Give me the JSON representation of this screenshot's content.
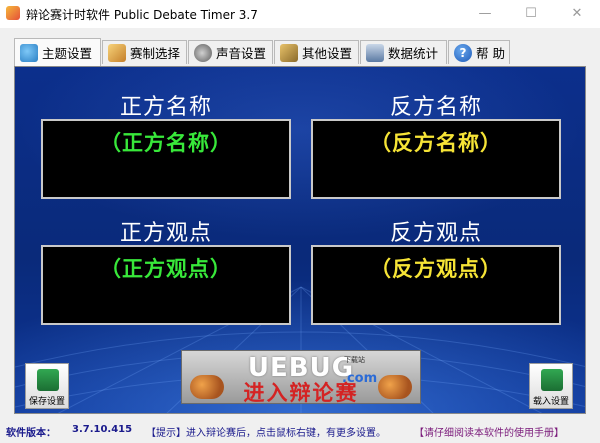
{
  "window": {
    "title": "辩论赛计时软件 Public Debate Timer 3.7",
    "controls": {
      "minimize": "—",
      "maximize": "☐",
      "close": "✕"
    }
  },
  "tabs": [
    {
      "label": "主题设置",
      "icon": "theme-settings-icon",
      "active": true
    },
    {
      "label": "赛制选择",
      "icon": "format-select-icon",
      "active": false
    },
    {
      "label": "声音设置",
      "icon": "speaker-icon",
      "active": false
    },
    {
      "label": "其他设置",
      "icon": "tools-icon",
      "active": false
    },
    {
      "label": "数据统计",
      "icon": "database-icon",
      "active": false
    },
    {
      "label": "帮 助",
      "icon": "help-icon",
      "active": false
    }
  ],
  "panel": {
    "affirmative_name_label": "正方名称",
    "affirmative_name_value": "（正方名称）",
    "negative_name_label": "反方名称",
    "negative_name_value": "（反方名称）",
    "affirmative_view_label": "正方观点",
    "affirmative_view_value": "（正方观点）",
    "negative_view_label": "反方观点",
    "negative_view_value": "（反方观点）",
    "enter_button": {
      "text": "进入辩论赛",
      "watermark": "UEBUG",
      "watermark_small": "下载站",
      "watermark_com": ".com"
    },
    "save_button": "保存设置",
    "load_button": "载入设置"
  },
  "statusbar": {
    "version_label": "软件版本：",
    "version_value": "3.7.10.415",
    "tip": "【提示】进入辩论赛后，点击鼠标右键，有更多设置。",
    "manual": "【请仔细阅读本软件的使用手册】"
  },
  "colors": {
    "panel_blue": "#0b2d86",
    "affirmative_value": "#38e83a",
    "negative_value": "#f6e436",
    "enter_text": "#d42323",
    "status_text": "#1a1a8c"
  }
}
